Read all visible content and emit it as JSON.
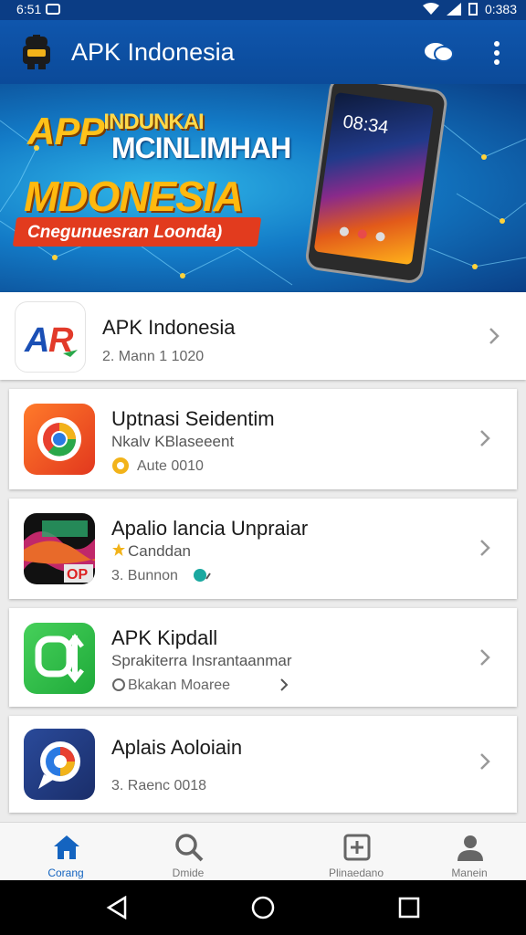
{
  "status_bar": {
    "time": "6:51",
    "right_text": "0:383"
  },
  "app_bar": {
    "title": "APK Indonesia",
    "icons": [
      "robot-logo-icon",
      "chat-icon",
      "more-vert-icon"
    ]
  },
  "banner": {
    "line1": "APP",
    "line1_small": "INDUNKAI",
    "line2": "MCINLIMHAH",
    "line3": "MDONESIA",
    "ribbon": "Cnegunuesran Loonda)",
    "phone_time": "08:34"
  },
  "apps": [
    {
      "title": "APK Indonesia",
      "sub": "",
      "meta": "2. Mann 1 1020",
      "icon": "apk-logo-icon"
    },
    {
      "title": "Uptnasi Seidentim",
      "sub": "Nkalv KBlaseeent",
      "meta": "Aute 0010",
      "icon": "chrome-style-icon"
    },
    {
      "title": "Apalio lancia Unpraiar",
      "sub": "Canddan",
      "meta": "3. Bunnon",
      "icon": "game-art-icon"
    },
    {
      "title": "APK Kipdall",
      "sub": "Sprakiterra Insrantaanmar",
      "meta": "Bkakan Moaree",
      "icon": "green-chat-icon"
    },
    {
      "title": "Aplais Aoloiain",
      "sub": "",
      "meta": "3. Raenc 0018",
      "icon": "blue-chat-icon"
    }
  ],
  "bottom_nav": [
    {
      "label": "Corang",
      "icon": "home-icon",
      "active": true
    },
    {
      "label": "Dmide",
      "icon": "search-icon",
      "active": false
    },
    {
      "label": "Plinaedano",
      "icon": "add-box-icon",
      "active": false
    },
    {
      "label": "Manein",
      "icon": "person-icon",
      "active": false
    }
  ],
  "colors": {
    "primary": "#0f56ad",
    "accent": "#1464c0"
  }
}
